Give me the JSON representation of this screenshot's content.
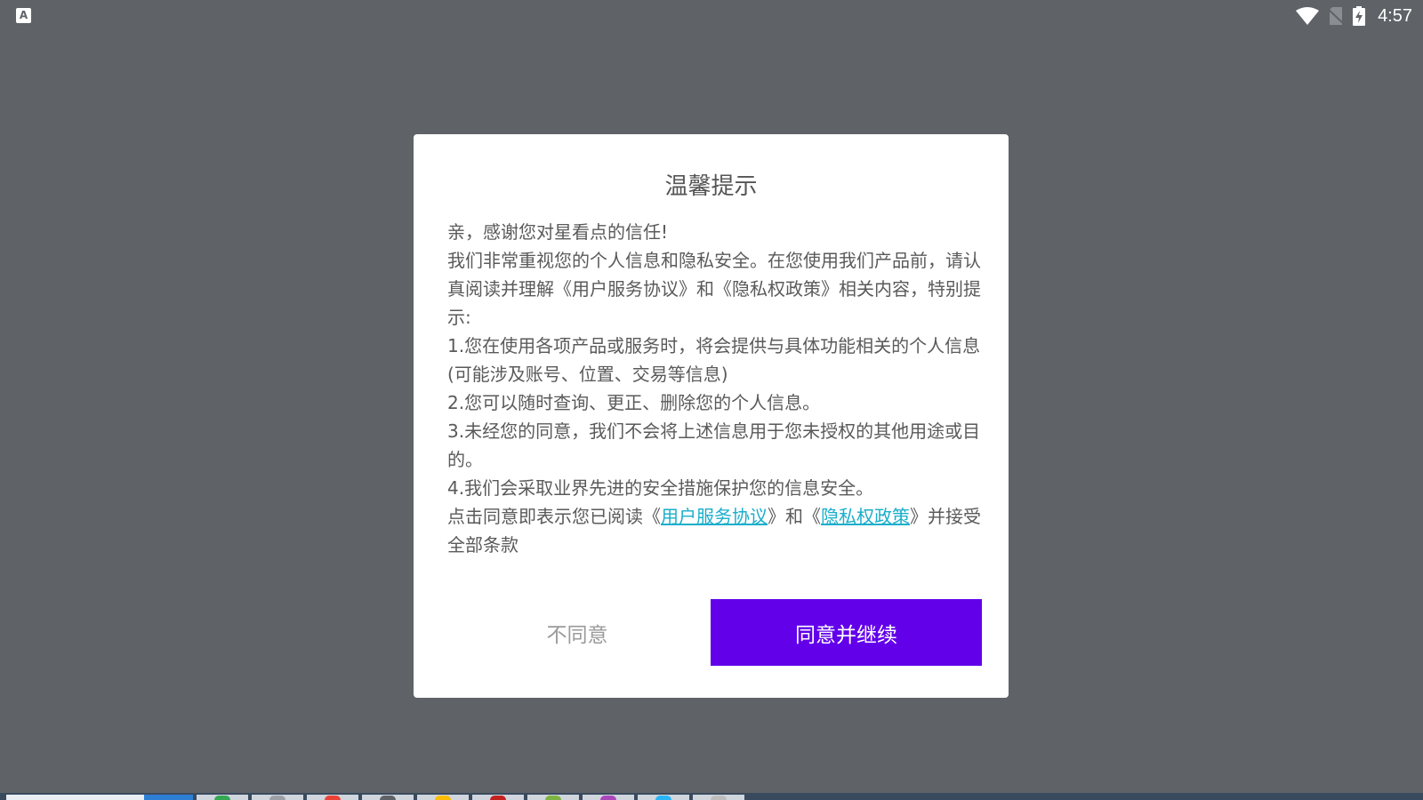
{
  "status_bar": {
    "app_icon_letter": "A",
    "time": "4:57",
    "icons": [
      "wifi-icon",
      "no-sim-icon",
      "battery-charging-icon"
    ]
  },
  "dialog": {
    "title": "温馨提示",
    "lines": [
      "亲，感谢您对星看点的信任!",
      "我们非常重视您的个人信息和隐私安全。在您使用我们产品前，请认真阅读并理解《用户服务协议》和《隐私权政策》相关内容，特别提示:",
      "1.您在使用各项产品或服务时，将会提供与具体功能相关的个人信息(可能涉及账号、位置、交易等信息)",
      "2.您可以随时查询、更正、删除您的个人信息。",
      "3.未经您的同意，我们不会将上述信息用于您未授权的其他用途或目的。",
      "4.我们会采取业界先进的安全措施保护您的信息安全。"
    ],
    "consent": {
      "prefix": "点击同意即表示您已阅读《",
      "link_terms": "用户服务协议",
      "middle": "》和《",
      "link_privacy": "隐私权政策",
      "suffix": "》并接受全部条款"
    },
    "disagree_label": "不同意",
    "agree_label": "同意并继续"
  },
  "colors": {
    "background": "#5f6368",
    "accent": "#6200ea",
    "link": "#1aaecb"
  }
}
